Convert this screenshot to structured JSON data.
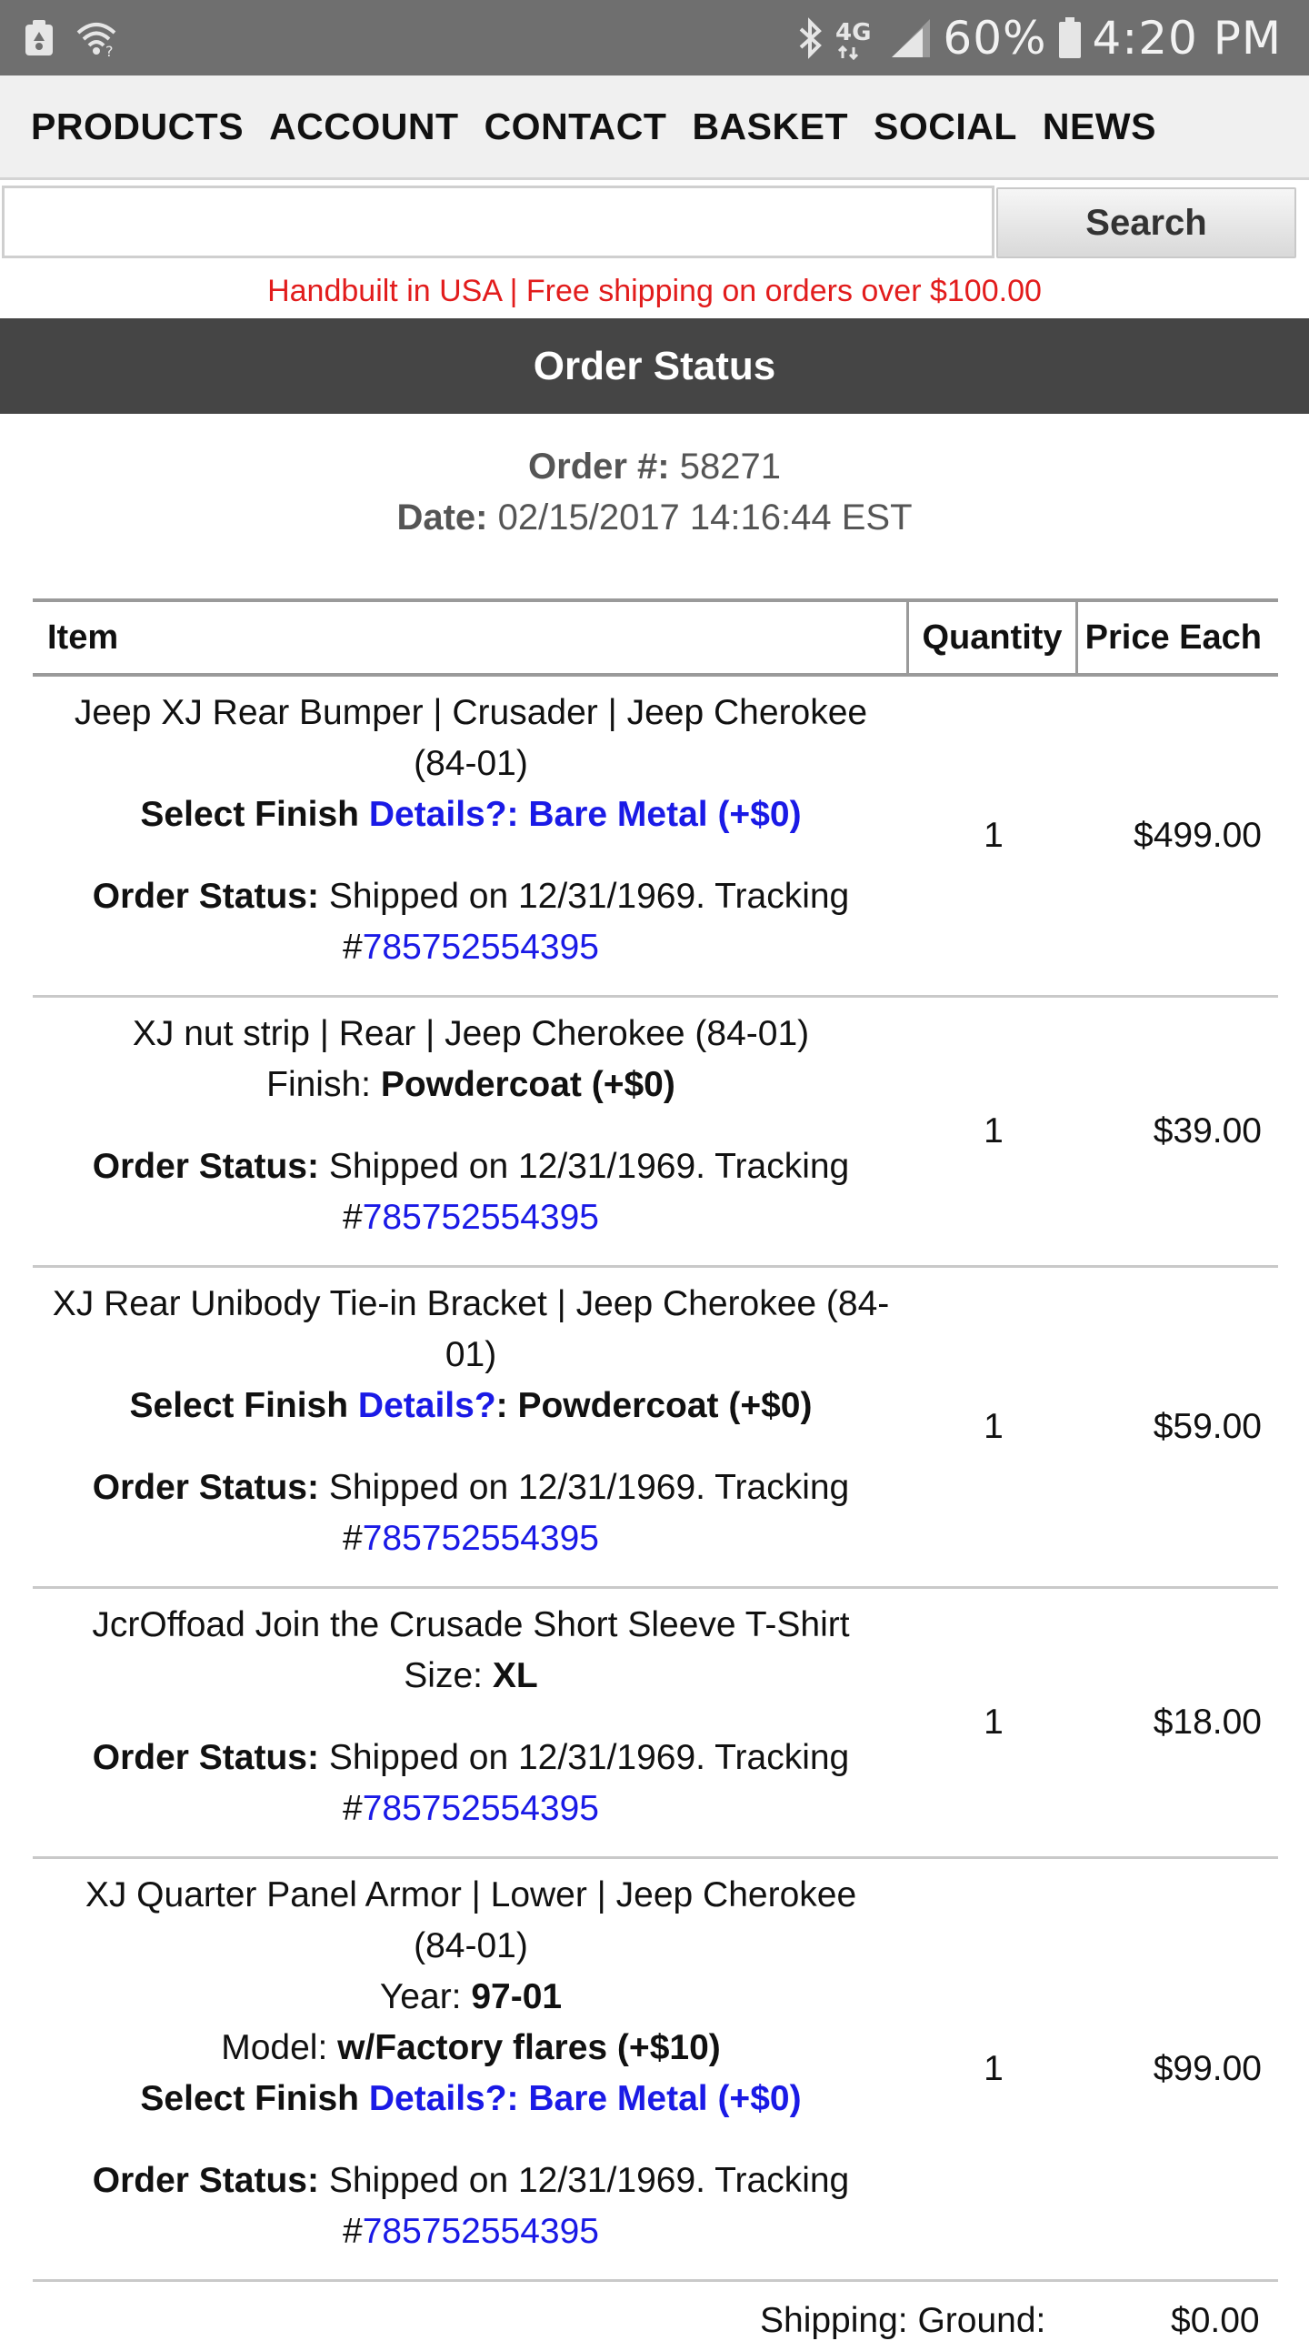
{
  "status_bar": {
    "icons": [
      "recycle-notification-icon",
      "wifi-question-icon",
      "bluetooth-icon",
      "4g-lte-icon",
      "signal-icon",
      "battery-icon"
    ],
    "network": "4G",
    "battery": "60%",
    "time": "4:20 PM"
  },
  "nav": {
    "items": [
      "PRODUCTS",
      "ACCOUNT",
      "CONTACT",
      "BASKET",
      "SOCIAL",
      "NEWS"
    ]
  },
  "search": {
    "value": "",
    "placeholder": "",
    "button_label": "Search"
  },
  "promo": "Handbuilt in USA | Free shipping on orders over $100.00",
  "page_title": "Order Status",
  "order": {
    "number_label": "Order #:",
    "number": "58271",
    "date_label": "Date:",
    "date": "02/15/2017 14:16:44 EST"
  },
  "table": {
    "headers": [
      "Item",
      "Quantity",
      "Price Each"
    ],
    "status_label": "Order Status:",
    "status_text": "Shipped on 12/31/1969. Tracking",
    "tracking_hash": "#",
    "tracking": "785752554395",
    "rows": [
      {
        "name": "Jeep XJ Rear Bumper | Crusader | Jeep Cherokee (84-01)",
        "options": [
          {
            "label": "Select Finish",
            "link": "Details?: Bare Metal (+$0)",
            "value": ""
          }
        ],
        "qty": "1",
        "price": "$499.00"
      },
      {
        "name": "XJ nut strip | Rear | Jeep Cherokee (84-01)",
        "options": [
          {
            "label": "Finish:",
            "link": "",
            "value": "Powdercoat (+$0)"
          }
        ],
        "qty": "1",
        "price": "$39.00"
      },
      {
        "name": "XJ Rear Unibody Tie-in Bracket | Jeep Cherokee (84-01)",
        "options": [
          {
            "label": "Select Finish",
            "link": "Details?",
            "value": ": Powdercoat (+$0)"
          }
        ],
        "qty": "1",
        "price": "$59.00"
      },
      {
        "name": "JcrOffoad Join the Crusade Short Sleeve T-Shirt",
        "options": [
          {
            "label": "Size:",
            "link": "",
            "value": "XL"
          }
        ],
        "qty": "1",
        "price": "$18.00"
      },
      {
        "name": "XJ Quarter Panel Armor | Lower | Jeep Cherokee (84-01)",
        "options": [
          {
            "label": "Year:",
            "link": "",
            "value": "97-01"
          },
          {
            "label": "Model:",
            "link": "",
            "value": "w/Factory flares (+$10)"
          },
          {
            "label": "Select Finish",
            "link": "Details?: Bare Metal (+$0)",
            "value": ""
          }
        ],
        "qty": "1",
        "price": "$99.00"
      }
    ]
  },
  "shipping": {
    "label": "Shipping: Ground:",
    "value": "$0.00"
  },
  "colors": {
    "status_bar": "#6f6f6f",
    "title_bar": "#454545",
    "promo_red": "#e21c1c",
    "link_blue": "#1a1ae6"
  }
}
